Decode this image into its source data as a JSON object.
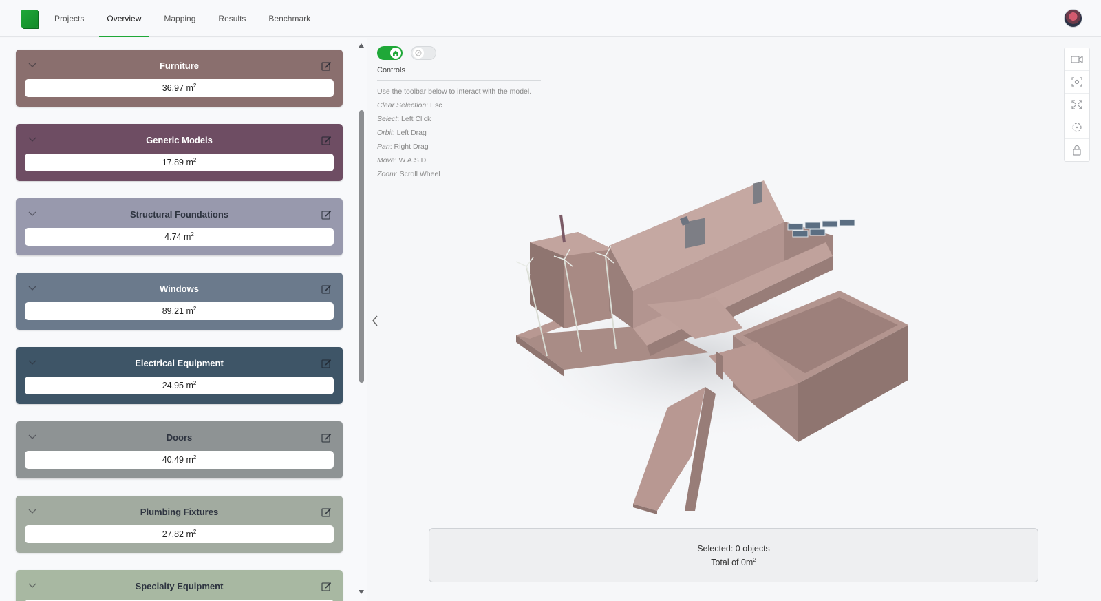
{
  "nav": {
    "items": [
      {
        "label": "Projects",
        "active": false
      },
      {
        "label": "Overview",
        "active": true
      },
      {
        "label": "Mapping",
        "active": false
      },
      {
        "label": "Results",
        "active": false
      },
      {
        "label": "Benchmark",
        "active": false
      }
    ]
  },
  "categories": [
    {
      "title": "Furniture",
      "value": "36.97 m",
      "unit_exp": "2",
      "color": "#8a6f6e"
    },
    {
      "title": "Generic Models",
      "value": "17.89 m",
      "unit_exp": "2",
      "color": "#6e4d63"
    },
    {
      "title": "Structural Foundations",
      "value": "4.74 m",
      "unit_exp": "2",
      "color": "#9899ad"
    },
    {
      "title": "Windows",
      "value": "89.21 m",
      "unit_exp": "2",
      "color": "#6b7a8c"
    },
    {
      "title": "Electrical Equipment",
      "value": "24.95 m",
      "unit_exp": "2",
      "color": "#3e5567"
    },
    {
      "title": "Doors",
      "value": "40.49 m",
      "unit_exp": "2",
      "color": "#8e9394"
    },
    {
      "title": "Plumbing Fixtures",
      "value": "27.82 m",
      "unit_exp": "2",
      "color": "#a2aba0"
    },
    {
      "title": "Specialty Equipment",
      "value": "",
      "unit_exp": "",
      "color": "#a8b8a2"
    }
  ],
  "controls": {
    "title": "Controls",
    "intro": "Use the toolbar below to interact with the model.",
    "lines": [
      {
        "key": "Clear Selection",
        "value": ": Esc"
      },
      {
        "key": "Select",
        "value": ": Left Click"
      },
      {
        "key": "Orbit",
        "value": ": Left Drag"
      },
      {
        "key": "Pan",
        "value": ": Right Drag"
      },
      {
        "key": "Move",
        "value": ": W.A.S.D"
      },
      {
        "key": "Zoom",
        "value": ": Scroll Wheel"
      }
    ]
  },
  "toolbar_icons": [
    "video-camera-icon",
    "focus-icon",
    "expand-icon",
    "center-icon",
    "lock-icon"
  ],
  "status": {
    "selected": "Selected: 0 objects",
    "total": "Total of 0m",
    "total_exp": "2"
  },
  "colors": {
    "accent": "#1fa838",
    "model": "#b89892"
  }
}
